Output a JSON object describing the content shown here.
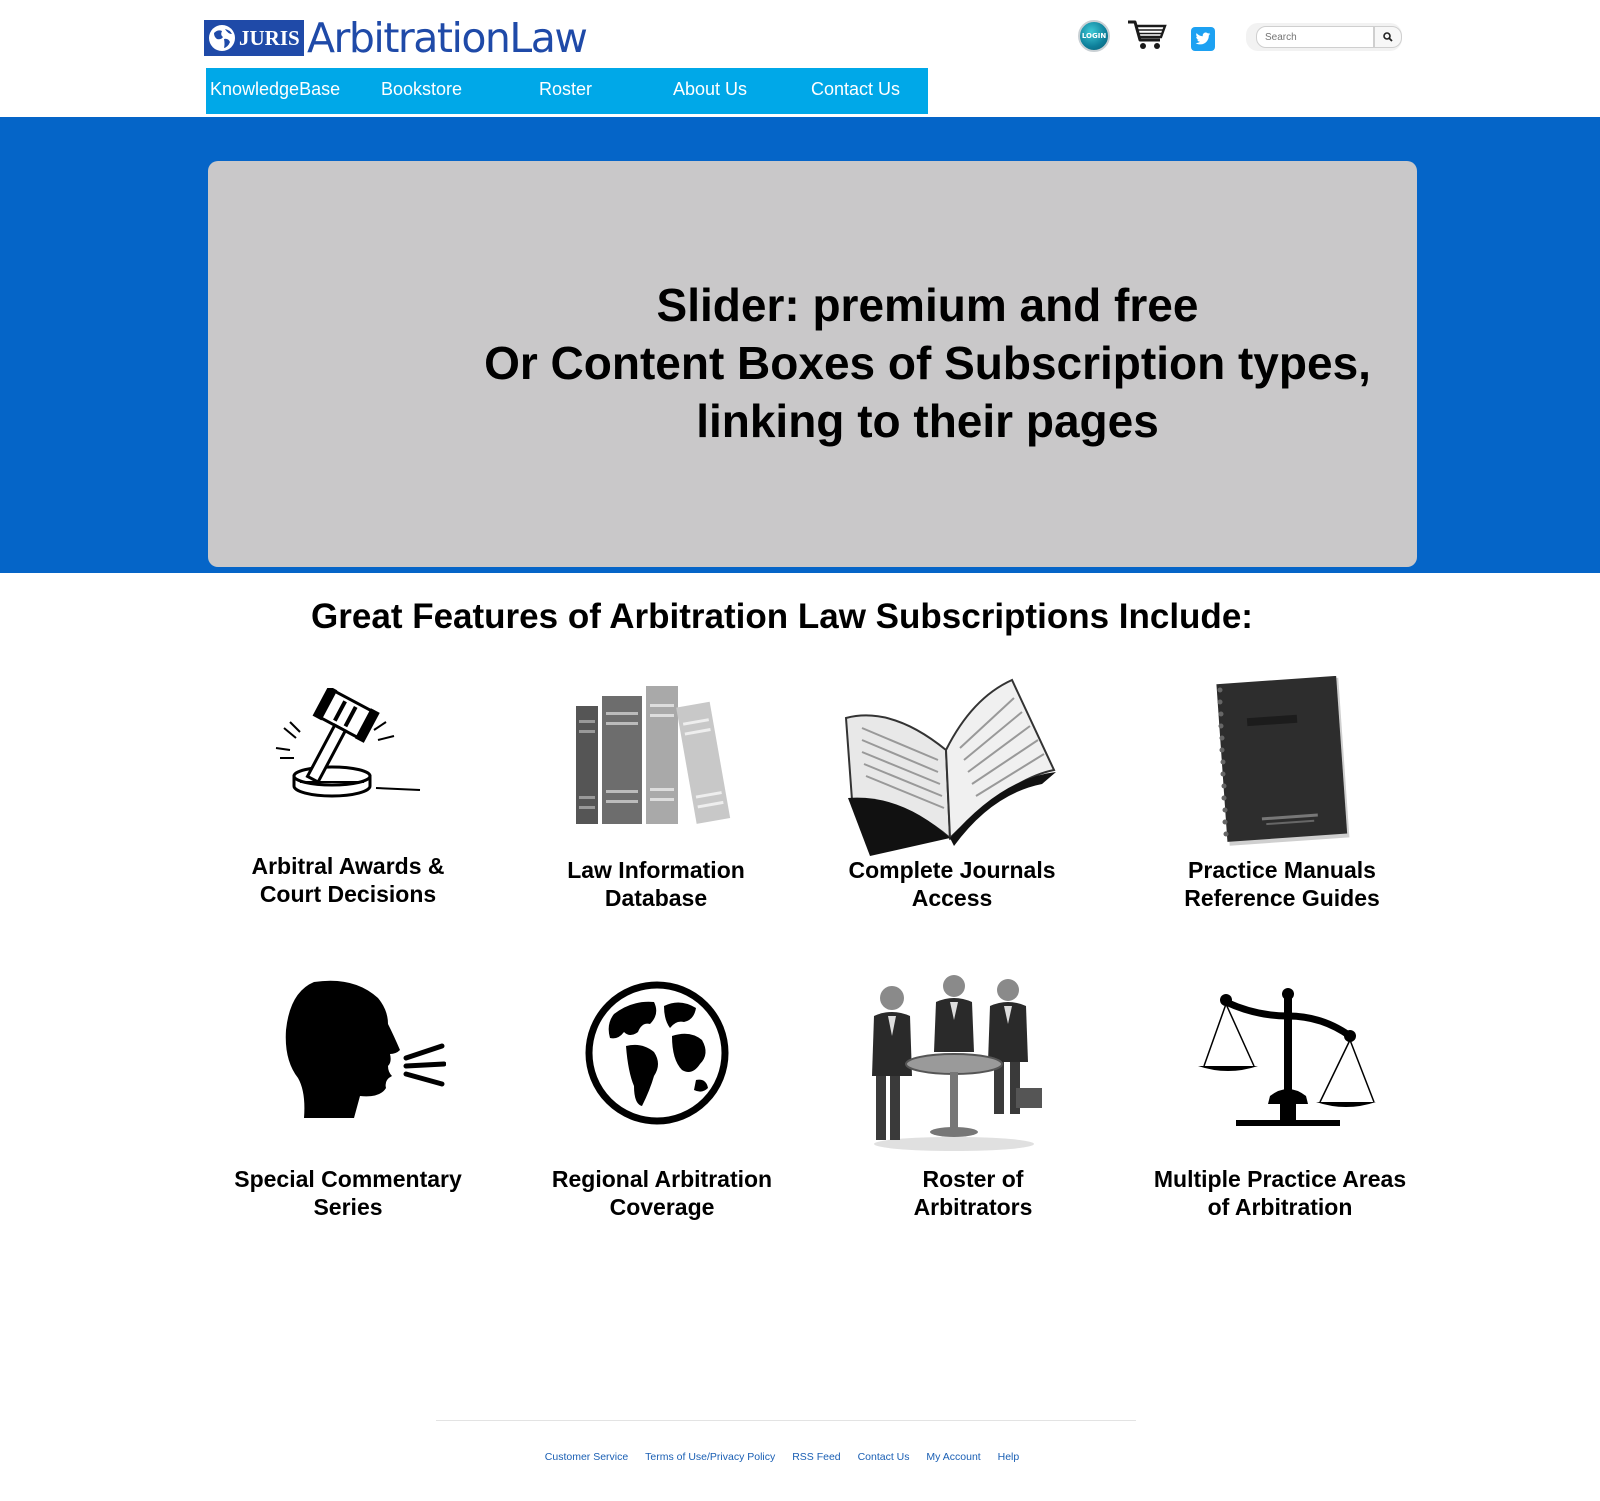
{
  "header": {
    "logo_badge": "JURIS",
    "logo_text": "ArbitrationLaw",
    "login_label": "LOGIN",
    "search_placeholder": "Search",
    "icons": [
      "globe-icon",
      "login-icon",
      "cart-icon",
      "twitter-icon",
      "search-icon"
    ]
  },
  "nav": {
    "items": [
      {
        "label": "KnowledgeBase"
      },
      {
        "label": "Bookstore"
      },
      {
        "label": "Roster"
      },
      {
        "label": "About Us"
      },
      {
        "label": "Contact Us"
      }
    ]
  },
  "slider": {
    "line1": "Slider: premium and free",
    "line2": "Or Content Boxes of Subscription types,",
    "line3": "linking to their pages"
  },
  "features": {
    "title": "Great Features of Arbitration Law Subscriptions Include:",
    "items": [
      {
        "line1": "Arbitral Awards &",
        "line2": "Court Decisions",
        "icon": "gavel-icon"
      },
      {
        "line1": "Law Information",
        "line2": "Database",
        "icon": "books-icon"
      },
      {
        "line1": "Complete Journals",
        "line2": "Access",
        "icon": "open-book-icon"
      },
      {
        "line1": "Practice Manuals",
        "line2": "Reference Guides",
        "icon": "notebook-icon"
      },
      {
        "line1": "Special Commentary",
        "line2": "Series",
        "icon": "speaking-head-icon"
      },
      {
        "line1": "Regional Arbitration",
        "line2": "Coverage",
        "icon": "globe-icon"
      },
      {
        "line1": "Roster of",
        "line2": "Arbitrators",
        "icon": "people-table-icon"
      },
      {
        "line1": "Multiple Practice Areas",
        "line2": "of Arbitration",
        "icon": "scales-icon"
      }
    ]
  },
  "footer": {
    "links": [
      {
        "label": "Customer Service"
      },
      {
        "label": "Terms of Use/Privacy Policy"
      },
      {
        "label": "RSS Feed"
      },
      {
        "label": "Contact Us"
      },
      {
        "label": "My Account"
      },
      {
        "label": "Help"
      }
    ]
  },
  "colors": {
    "nav_bg": "#00a8e8",
    "hero_bg": "#0565c8",
    "slider_bg": "#c9c8c9",
    "brand_blue": "#1f4aa8",
    "footer_link": "#1a5fb4"
  }
}
